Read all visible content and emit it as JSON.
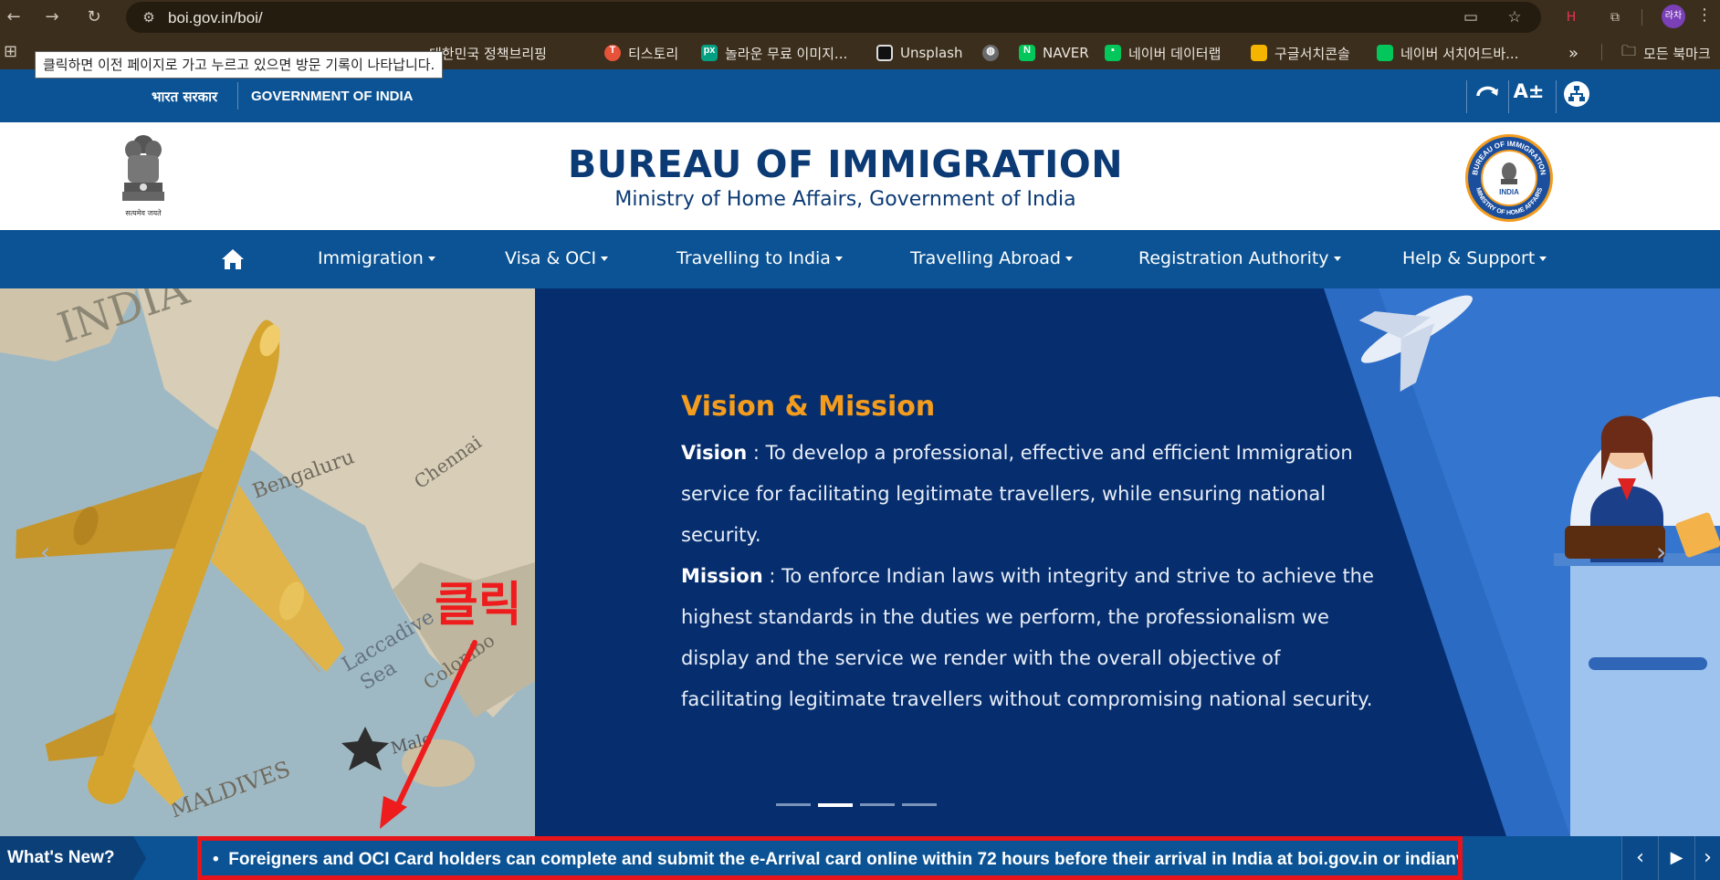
{
  "browser": {
    "url": "boi.gov.in/boi/",
    "tooltip": "클릭하면 이전 페이지로 가고 누르고 있으면 방문 기록이 나타납니다.",
    "profile_label": "라차",
    "back_icon": "←",
    "forward_icon": "→",
    "reload_icon": "↻",
    "more_bookmarks_icon": "»",
    "bookmarks": [
      {
        "label": "대한민국 정책브리핑",
        "icon_char": "",
        "color": "#c0392b"
      },
      {
        "label": "티스토리",
        "icon_char": "T",
        "color": "#e7523a"
      },
      {
        "label": "놀라운 무료 이미지...",
        "icon_char": "px",
        "color": "#05a081"
      },
      {
        "label": "Unsplash",
        "icon_char": "",
        "color": "#111111"
      },
      {
        "label": "",
        "icon_char": "",
        "color": "#6b6b6b"
      },
      {
        "label": "NAVER",
        "icon_char": "N",
        "color": "#03c75a"
      },
      {
        "label": "네이버 데이터랩",
        "icon_char": "▪",
        "color": "#03c75a"
      },
      {
        "label": "구글서치콘솔",
        "icon_char": "",
        "color": "#f4b400"
      },
      {
        "label": "네이버 서치어드바...",
        "icon_char": "",
        "color": "#03c75a"
      },
      {
        "label": "모든 북마크",
        "icon_char": "",
        "color": ""
      }
    ]
  },
  "govbar": {
    "hindi": "भारत सरकार",
    "english": "GOVERNMENT OF INDIA",
    "text_size_icon": "A±"
  },
  "header": {
    "title": "BUREAU OF IMMIGRATION",
    "subtitle": "Ministry of Home Affairs, Government of India",
    "emblem_motto": "सत्यमेव जयते",
    "seal_top_text": "BUREAU OF IMMIGRATION",
    "seal_bottom_text": "MINISTRY OF HOME AFFAIRS",
    "seal_center": "INDIA"
  },
  "menu": {
    "items": [
      "Immigration",
      "Visa & OCI",
      "Travelling to India",
      "Travelling Abroad",
      "Registration Authority",
      "Help & Support"
    ]
  },
  "hero": {
    "title": "Vision & Mission",
    "vision_label": "Vision",
    "vision_text": " : To develop a professional, effective and efficient Immigration service for facilitating legitimate travellers, while ensuring national security.",
    "mission_label": "Mission",
    "mission_text": " : To enforce Indian laws with integrity and strive to achieve the highest standards in the duties we perform, the professionalism we display and the service we render with the overall objective of facilitating legitimate travellers without compromising national security.",
    "map_label": "INDIA",
    "prev_icon": "‹",
    "next_icon": "›",
    "slide_count": 4,
    "active_slide": 2
  },
  "annotation": {
    "text": "클릭",
    "color": "#ee1c1c"
  },
  "ticker": {
    "label": "What's New?",
    "bullet": "•",
    "text": "Foreigners and OCI Card holders can complete and submit the e-Arrival card online within 72 hours before their arrival in India at boi.gov.in or indianvisaonline.gov.in or via o",
    "prev_icon": "‹",
    "play_icon": "▶",
    "next_icon": "›"
  },
  "colors": {
    "chrome": "#3b2e1c",
    "gov_blue": "#0b5394",
    "hero_navy": "#062e6e",
    "accent_orange": "#f39c1e",
    "title_navy": "#0b3a74"
  }
}
